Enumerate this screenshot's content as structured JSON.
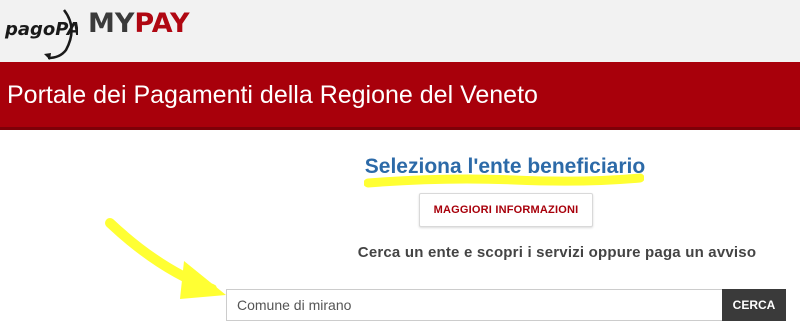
{
  "brand": {
    "pagopa_logo": "pagoPA",
    "mypay_my": "MY",
    "mypay_pay": "PAY"
  },
  "header": {
    "title": "Portale dei Pagamenti della Regione del Veneto"
  },
  "main": {
    "heading": "Seleziona l'ente beneficiario",
    "info_button": "MAGGIORI INFORMAZIONI",
    "subtitle": "Cerca un ente e scopri i servizi oppure paga un avviso",
    "search": {
      "value": "Comune di mirano",
      "button": "CERCA"
    }
  },
  "colors": {
    "brand_red": "#a8000b",
    "heading_blue": "#2c6aa8",
    "annotation_yellow": "#ffff33",
    "search_button": "#3a3a3a"
  }
}
